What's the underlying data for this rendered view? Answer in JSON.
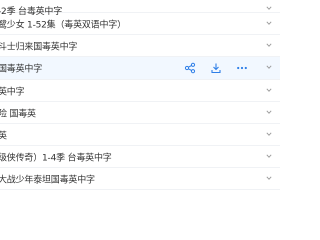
{
  "file_list": {
    "rows": [
      {
        "name": "-2季 台毒英中字"
      },
      {
        "name": "鹭少女 1-52集（毒英双语中字）"
      },
      {
        "name": "斗士归来国毒英中字"
      },
      {
        "name": "国毒英中字"
      },
      {
        "name": "英中字"
      },
      {
        "name": "险 国毒英"
      },
      {
        "name": "英"
      },
      {
        "name": "级侠传奇）1-4季 台毒英中字"
      },
      {
        "name": "大战少年泰坦国毒英中字"
      }
    ],
    "hover_actions": [
      "share-icon",
      "download-icon",
      "more-icon"
    ],
    "accent_color": "#2f7fe7"
  }
}
